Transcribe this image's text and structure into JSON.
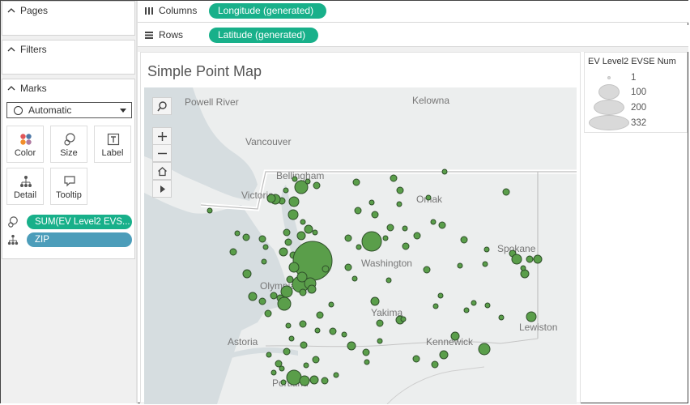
{
  "left_panel": {
    "pages_title": "Pages",
    "filters_title": "Filters",
    "marks_title": "Marks",
    "mark_type": "Automatic",
    "buttons": [
      {
        "label": "Color",
        "icon": "color-dots-icon"
      },
      {
        "label": "Size",
        "icon": "size-circles-icon"
      },
      {
        "label": "Label",
        "icon": "label-t-icon"
      },
      {
        "label": "Detail",
        "icon": "detail-hierarchy-icon"
      },
      {
        "label": "Tooltip",
        "icon": "tooltip-bubble-icon"
      }
    ],
    "mark_pills": [
      {
        "icon": "size-circles-icon",
        "label": "SUM(EV Level2 EVS...",
        "color": "#18b08a"
      },
      {
        "icon": "detail-hierarchy-icon",
        "label": "ZIP",
        "color": "#4c9dba"
      }
    ]
  },
  "shelves": {
    "columns_label": "Columns",
    "columns_pill": "Longitude (generated)",
    "rows_label": "Rows",
    "rows_pill": "Latitude (generated)"
  },
  "view": {
    "title": "Simple Point Map",
    "map_labels": [
      "Powell River",
      "Kelowna",
      "Vancouver",
      "Bellingham",
      "Victoria",
      "Omak",
      "Washington",
      "Olympia",
      "Spokane",
      "Yakima",
      "Kennewick",
      "Lewiston",
      "Astoria",
      "Portland"
    ],
    "mark_color": "#5a9e4a"
  },
  "legend": {
    "title": "EV Level2 EVSE Num",
    "items": [
      {
        "value": "1"
      },
      {
        "value": "100"
      },
      {
        "value": "200"
      },
      {
        "value": "332"
      }
    ]
  }
}
